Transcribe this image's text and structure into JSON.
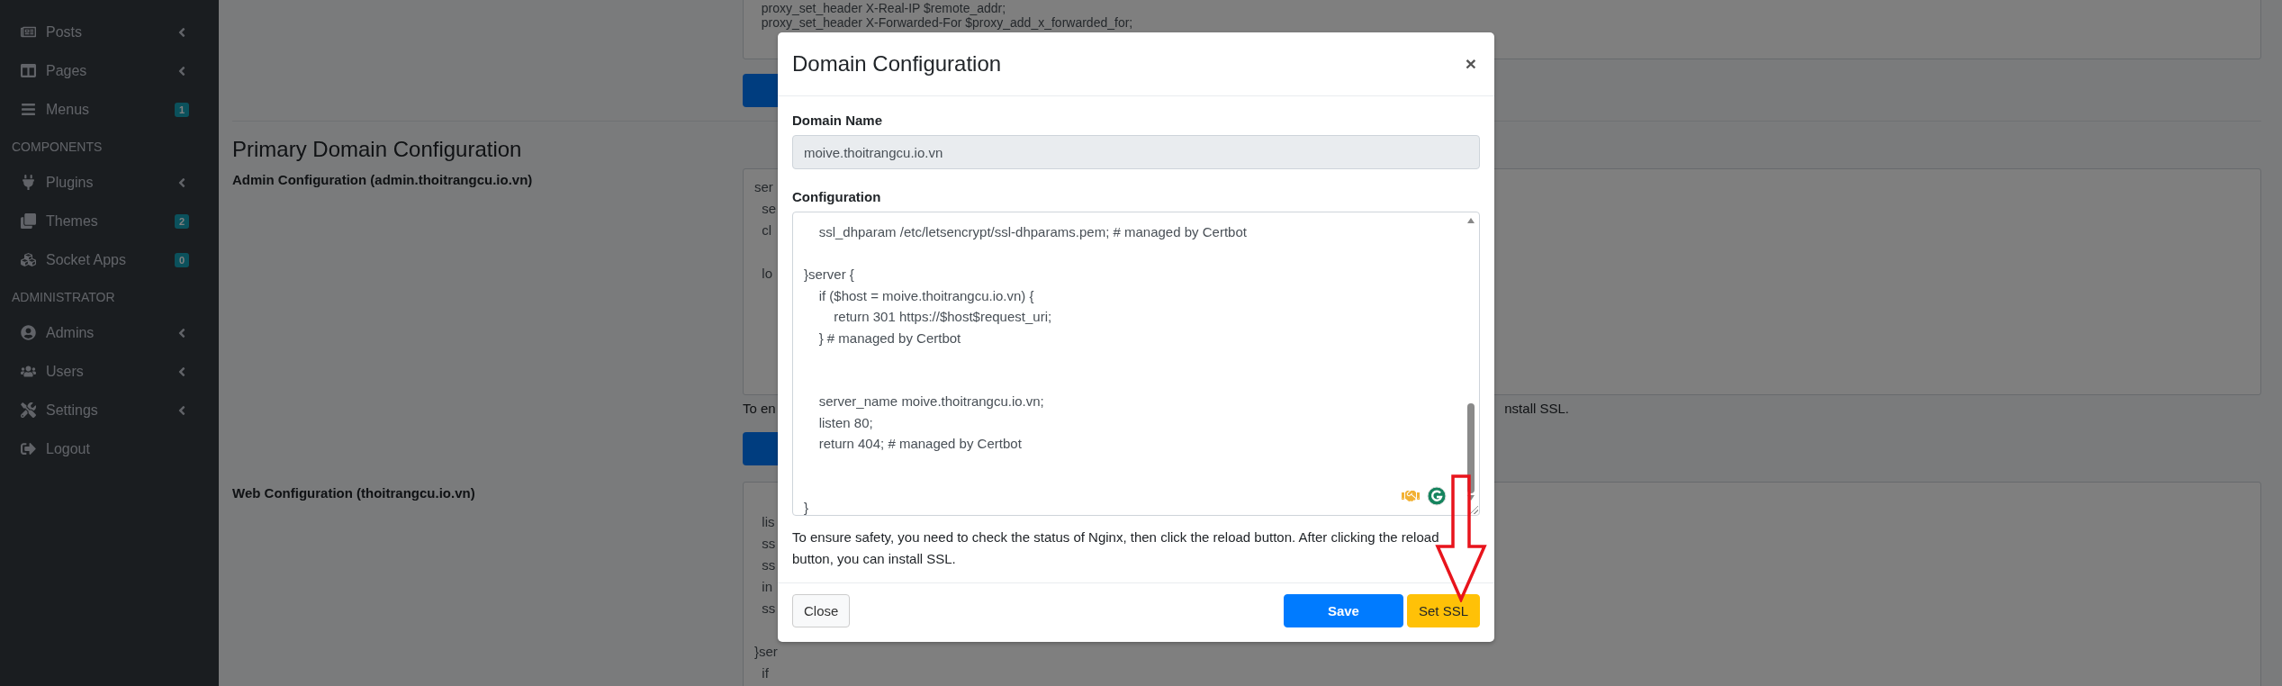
{
  "sidebar": {
    "sections": [
      {
        "items": [
          {
            "label": "Posts",
            "kind": "submenu"
          },
          {
            "label": "Pages",
            "kind": "submenu"
          },
          {
            "label": "Menus",
            "kind": "badge",
            "badge": "1"
          }
        ]
      },
      {
        "header": "COMPONENTS",
        "items": [
          {
            "label": "Plugins",
            "kind": "submenu"
          },
          {
            "label": "Themes",
            "kind": "badge",
            "badge": "2"
          },
          {
            "label": "Socket Apps",
            "kind": "badge",
            "badge": "0"
          }
        ]
      },
      {
        "header": "ADMINISTRATOR",
        "items": [
          {
            "label": "Admins",
            "kind": "submenu"
          },
          {
            "label": "Users",
            "kind": "submenu"
          },
          {
            "label": "Settings",
            "kind": "submenu"
          },
          {
            "label": "Logout",
            "kind": "link"
          }
        ]
      }
    ]
  },
  "page": {
    "top_config_lines": [
      "  proxy_set_header X-Real-IP $remote_addr;",
      "  proxy_set_header X-Forwarded-For $proxy_add_x_forwarded_for;"
    ],
    "heading": "Primary Domain Configuration",
    "configs": [
      {
        "label": "Admin Configuration (admin.thoitrangcu.io.vn)",
        "lines": [
          {
            "kind": "code",
            "text": "ser"
          },
          {
            "kind": "code",
            "text": "  se"
          },
          {
            "kind": "code",
            "text": "  cl"
          },
          {
            "kind": "blank"
          },
          {
            "kind": "code",
            "text": "  lo"
          }
        ],
        "note_start": "To en",
        "note_end": "nstall SSL."
      },
      {
        "label": "Web Configuration (thoitrangcu.io.vn)",
        "lines": [
          {
            "kind": "blank"
          },
          {
            "kind": "code",
            "text": "  lis"
          },
          {
            "kind": "code",
            "text": "  ss"
          },
          {
            "kind": "code",
            "text": "  ss"
          },
          {
            "kind": "code",
            "text": "  in"
          },
          {
            "kind": "code",
            "text": "  ss"
          },
          {
            "kind": "blank"
          },
          {
            "kind": "code",
            "text": "}ser"
          },
          {
            "kind": "code",
            "text": "  if"
          }
        ]
      }
    ]
  },
  "modal": {
    "title": "Domain Configuration",
    "close": "×",
    "domain_label": "Domain Name",
    "domain_value": "moive.thoitrangcu.io.vn",
    "config_label": "Configuration",
    "config_lines": [
      {
        "kind": "code",
        "text": "    ssl_dhparam /etc/letsencrypt/ssl-dhparams.pem; # managed by Certbot"
      },
      {
        "kind": "blank"
      },
      {
        "kind": "code",
        "text": "}server {"
      },
      {
        "kind": "code",
        "text": "    if ($host = moive.thoitrangcu.io.vn) {"
      },
      {
        "kind": "code",
        "text": "        return 301 https://$host$request_uri;"
      },
      {
        "kind": "code",
        "text": "    } # managed by Certbot"
      },
      {
        "kind": "blank"
      },
      {
        "kind": "blank"
      },
      {
        "kind": "code",
        "text": "    server_name moive.thoitrangcu.io.vn;"
      },
      {
        "kind": "code",
        "text": "    listen 80;"
      },
      {
        "kind": "code",
        "text": "    return 404; # managed by Certbot"
      },
      {
        "kind": "blank"
      },
      {
        "kind": "blank"
      },
      {
        "kind": "code",
        "text": "}"
      }
    ],
    "help": "To ensure safety, you need to check the status of Nginx, then click the reload button. After clicking the reload button, you can install SSL.",
    "buttons": [
      {
        "label": "Close",
        "kind": "secondary"
      },
      {
        "label": "Save",
        "kind": "primary"
      },
      {
        "label": "Set SSL",
        "kind": "warning"
      }
    ]
  }
}
